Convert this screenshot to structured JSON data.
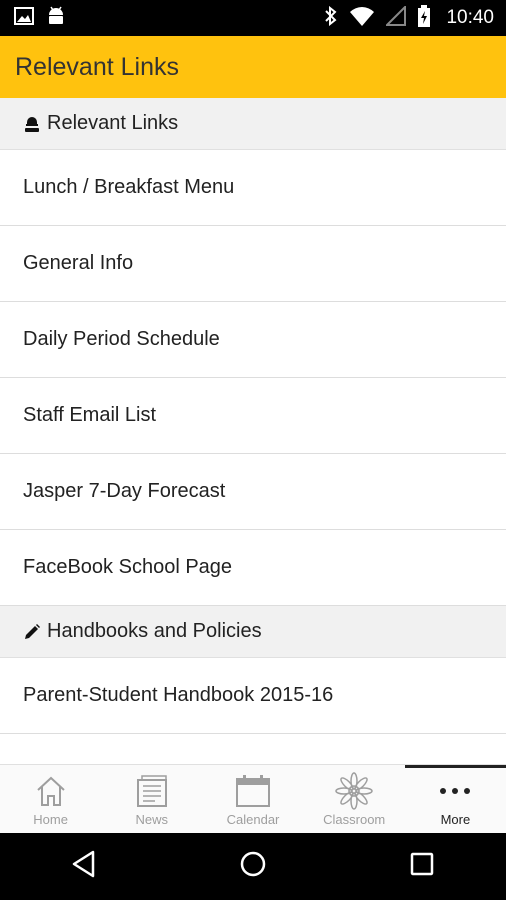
{
  "status_bar": {
    "time": "10:40",
    "left_icons": [
      "image-icon",
      "android-icon"
    ],
    "right_icons": [
      "bluetooth-icon",
      "wifi-icon",
      "signal-icon",
      "battery-icon"
    ]
  },
  "app_bar": {
    "title": "Relevant Links",
    "color": "#FFC20E"
  },
  "sections": [
    {
      "title": "Relevant Links",
      "icon": "person-icon",
      "items": [
        "Lunch / Breakfast Menu",
        "General Info",
        "Daily Period Schedule",
        "Staff Email List",
        "Jasper 7-Day Forecast",
        "FaceBook School Page"
      ]
    },
    {
      "title": "Handbooks and Policies",
      "icon": "pencil-icon",
      "items": [
        "Parent-Student Handbook 2015-16"
      ]
    }
  ],
  "bottom_nav": {
    "active": "More",
    "items": [
      {
        "label": "Home",
        "icon": "home-icon"
      },
      {
        "label": "News",
        "icon": "news-icon"
      },
      {
        "label": "Calendar",
        "icon": "calendar-icon"
      },
      {
        "label": "Classroom",
        "icon": "classroom-icon"
      },
      {
        "label": "More",
        "icon": "more-icon"
      }
    ]
  },
  "system_nav": [
    "back-icon",
    "home-circle-icon",
    "recents-icon"
  ]
}
